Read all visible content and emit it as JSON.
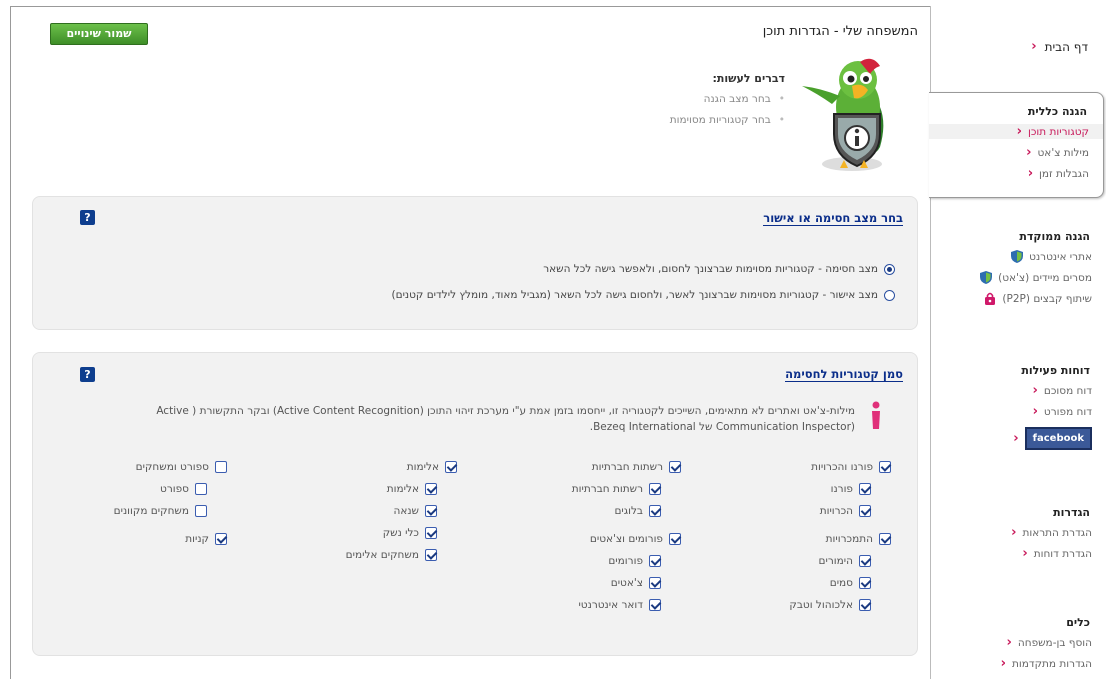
{
  "header": {
    "title": "המשפחה שלי - הגדרות תוכן",
    "save_label": "שמור שינויים"
  },
  "todo": {
    "title": "דברים לעשות:",
    "items": [
      "בחר מצב הגנה",
      "בחר קטגוריות מסוימות"
    ]
  },
  "sidebar": {
    "home": "דף הבית",
    "general": {
      "title": "הגנה כללית",
      "items": [
        "קטגוריות תוכן",
        "מילות צ'אט",
        "הגבלות זמן"
      ]
    },
    "focused": {
      "title": "הגנה ממוקדת",
      "items": [
        "אתרי אינטרנט",
        "מסרים מיידים (צ'אט)",
        "שיתוף קבצים (P2P)"
      ]
    },
    "reports": {
      "title": "דוחות פעילות",
      "items": [
        "דוח מסוכם",
        "דוח מפורט"
      ],
      "facebook": "facebook"
    },
    "settings": {
      "title": "הגדרות",
      "items": [
        "הגדרת התראות",
        "הגדרת דוחות"
      ]
    },
    "tools": {
      "title": "כלים",
      "items": [
        "הוסף בן-משפחה",
        "הגדרות מתקדמות"
      ]
    }
  },
  "mode_panel": {
    "title": "בחר מצב חסימה או אישור",
    "help": "?",
    "options": [
      {
        "label": "מצב חסימה - קטגוריות מסוימות שברצונך לחסום, ולאפשר גישה לכל השאר",
        "selected": true
      },
      {
        "label": "מצב אישור - קטגוריות מסוימות שברצונך לאשר, ולחסום גישה לכל השאר (מגביל מאוד, מומלץ לילדים קטנים)",
        "selected": false
      }
    ]
  },
  "categories_panel": {
    "title": "סמן קטגוריות לחסימה",
    "help": "?",
    "info_line1": "מילות-צ'אט ואתרים לא מתאימים, השייכים לקטגוריה זו, ייחסמו בזמן אמת ע\"י מערכת זיהוי התוכן (Active Content Recognition) ובקר התקשורת ( Active",
    "info_line2": "(Communication Inspector של Bezeq International.",
    "columns": [
      {
        "groups": [
          {
            "label": "פורנו והכרויות",
            "checked": true,
            "children": [
              {
                "label": "פורנו",
                "checked": true
              },
              {
                "label": "הכרויות",
                "checked": true
              }
            ]
          },
          {
            "label": "התמכרויות",
            "checked": true,
            "children": [
              {
                "label": "הימורים",
                "checked": true
              },
              {
                "label": "סמים",
                "checked": true
              },
              {
                "label": "אלכוהול וטבק",
                "checked": true
              }
            ]
          }
        ]
      },
      {
        "groups": [
          {
            "label": "רשתות חברתיות",
            "checked": true,
            "children": [
              {
                "label": "רשתות חברתיות",
                "checked": true
              },
              {
                "label": "בלוגים",
                "checked": true
              }
            ]
          },
          {
            "label": "פורומים וצ'אטים",
            "checked": true,
            "children": [
              {
                "label": "פורומים",
                "checked": true
              },
              {
                "label": "צ'אטים",
                "checked": true
              },
              {
                "label": "דואר אינטרנטי",
                "checked": true
              }
            ]
          }
        ]
      },
      {
        "groups": [
          {
            "label": "אלימות",
            "checked": true,
            "children": [
              {
                "label": "אלימות",
                "checked": true
              },
              {
                "label": "שנאה",
                "checked": true
              },
              {
                "label": "כלי נשק",
                "checked": true
              },
              {
                "label": "משחקים אלימים",
                "checked": true
              }
            ]
          }
        ]
      },
      {
        "groups": [
          {
            "label": "ספורט ומשחקים",
            "checked": false,
            "children": [
              {
                "label": "ספורט",
                "checked": false
              },
              {
                "label": "משחקים מקוונים",
                "checked": false
              }
            ]
          },
          {
            "label": "קניות",
            "checked": true,
            "children": []
          }
        ]
      }
    ]
  }
}
